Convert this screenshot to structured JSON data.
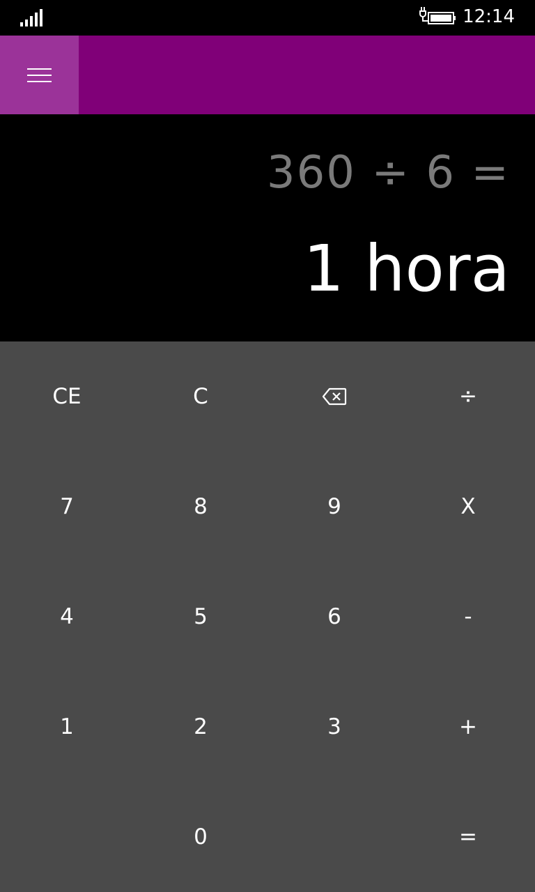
{
  "status_bar": {
    "time": "12:14",
    "signal_icon": "signal-strength-icon",
    "battery_icon": "battery-charging-icon"
  },
  "header": {
    "menu_icon": "hamburger-menu-icon"
  },
  "display": {
    "expression": "360 ÷ 6 =",
    "result": "1 hora"
  },
  "keypad": {
    "clear_entry": "CE",
    "clear": "C",
    "backspace_icon": "backspace-icon",
    "divide": "÷",
    "seven": "7",
    "eight": "8",
    "nine": "9",
    "multiply": "X",
    "four": "4",
    "five": "5",
    "six": "6",
    "subtract": "-",
    "one": "1",
    "two": "2",
    "three": "3",
    "add": "+",
    "zero": "0",
    "equals": "="
  },
  "colors": {
    "accent_purple": "#800078",
    "menu_button_bg": "#9b3399",
    "keypad_bg": "#4a4a4a",
    "display_bg": "#000000",
    "expression_text": "#7a7a7a",
    "result_text": "#ffffff"
  }
}
